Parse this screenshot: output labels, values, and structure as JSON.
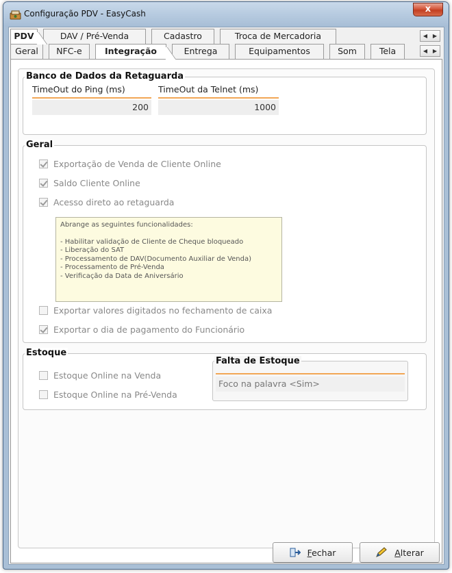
{
  "window": {
    "title": "Configuração PDV - EasyCash",
    "close_label": "x"
  },
  "tabs_row1": [
    {
      "label": "PDV",
      "active": true
    },
    {
      "label": "DAV / Pré-Venda",
      "active": false
    },
    {
      "label": "Cadastro",
      "active": false
    },
    {
      "label": "Troca de Mercadoria",
      "active": false
    }
  ],
  "tabs_row2": [
    {
      "label": "Geral",
      "active": false
    },
    {
      "label": "NFC-e",
      "active": false
    },
    {
      "label": "Integração",
      "active": true
    },
    {
      "label": "Entrega",
      "active": false
    },
    {
      "label": "Equipamentos",
      "active": false
    },
    {
      "label": "Som",
      "active": false
    },
    {
      "label": "Tela",
      "active": false
    }
  ],
  "scroll": {
    "left": "◀",
    "right": "▶"
  },
  "banco": {
    "title": "Banco de Dados da Retaguarda",
    "ping_label": "TimeOut do Ping (ms)",
    "ping_value": "200",
    "telnet_label": "TimeOut da Telnet (ms)",
    "telnet_value": "1000"
  },
  "geral": {
    "title": "Geral",
    "options": [
      {
        "label": "Exportação de Venda de Cliente Online",
        "checked": true
      },
      {
        "label": "Saldo Cliente Online",
        "checked": true
      },
      {
        "label": "Acesso direto ao retaguarda",
        "checked": true
      }
    ],
    "note": {
      "heading": "Abrange as seguintes funcionalidades:",
      "items": [
        "- Habilitar validação de Cliente de Cheque bloqueado",
        "- Liberação do SAT",
        "- Processamento de DAV(Documento Auxiliar de Venda)",
        "- Processamento de Pré-Venda",
        "- Verificação da Data de Aniversário"
      ]
    },
    "options_after": [
      {
        "label": "Exportar valores digitados no fechamento de caixa",
        "checked": false
      },
      {
        "label": "Exportar o dia de pagamento do Funcionário",
        "checked": true
      }
    ]
  },
  "estoque": {
    "title": "Estoque",
    "options": [
      {
        "label": "Estoque Online na Venda",
        "checked": false
      },
      {
        "label": "Estoque Online na Pré-Venda",
        "checked": false
      }
    ],
    "falta_title": "Falta de Estoque",
    "falta_value": "Foco na palavra <Sim>"
  },
  "buttons": {
    "fechar_first": "F",
    "fechar_rest": "echar",
    "alterar_first": "A",
    "alterar_rest": "lterar"
  }
}
